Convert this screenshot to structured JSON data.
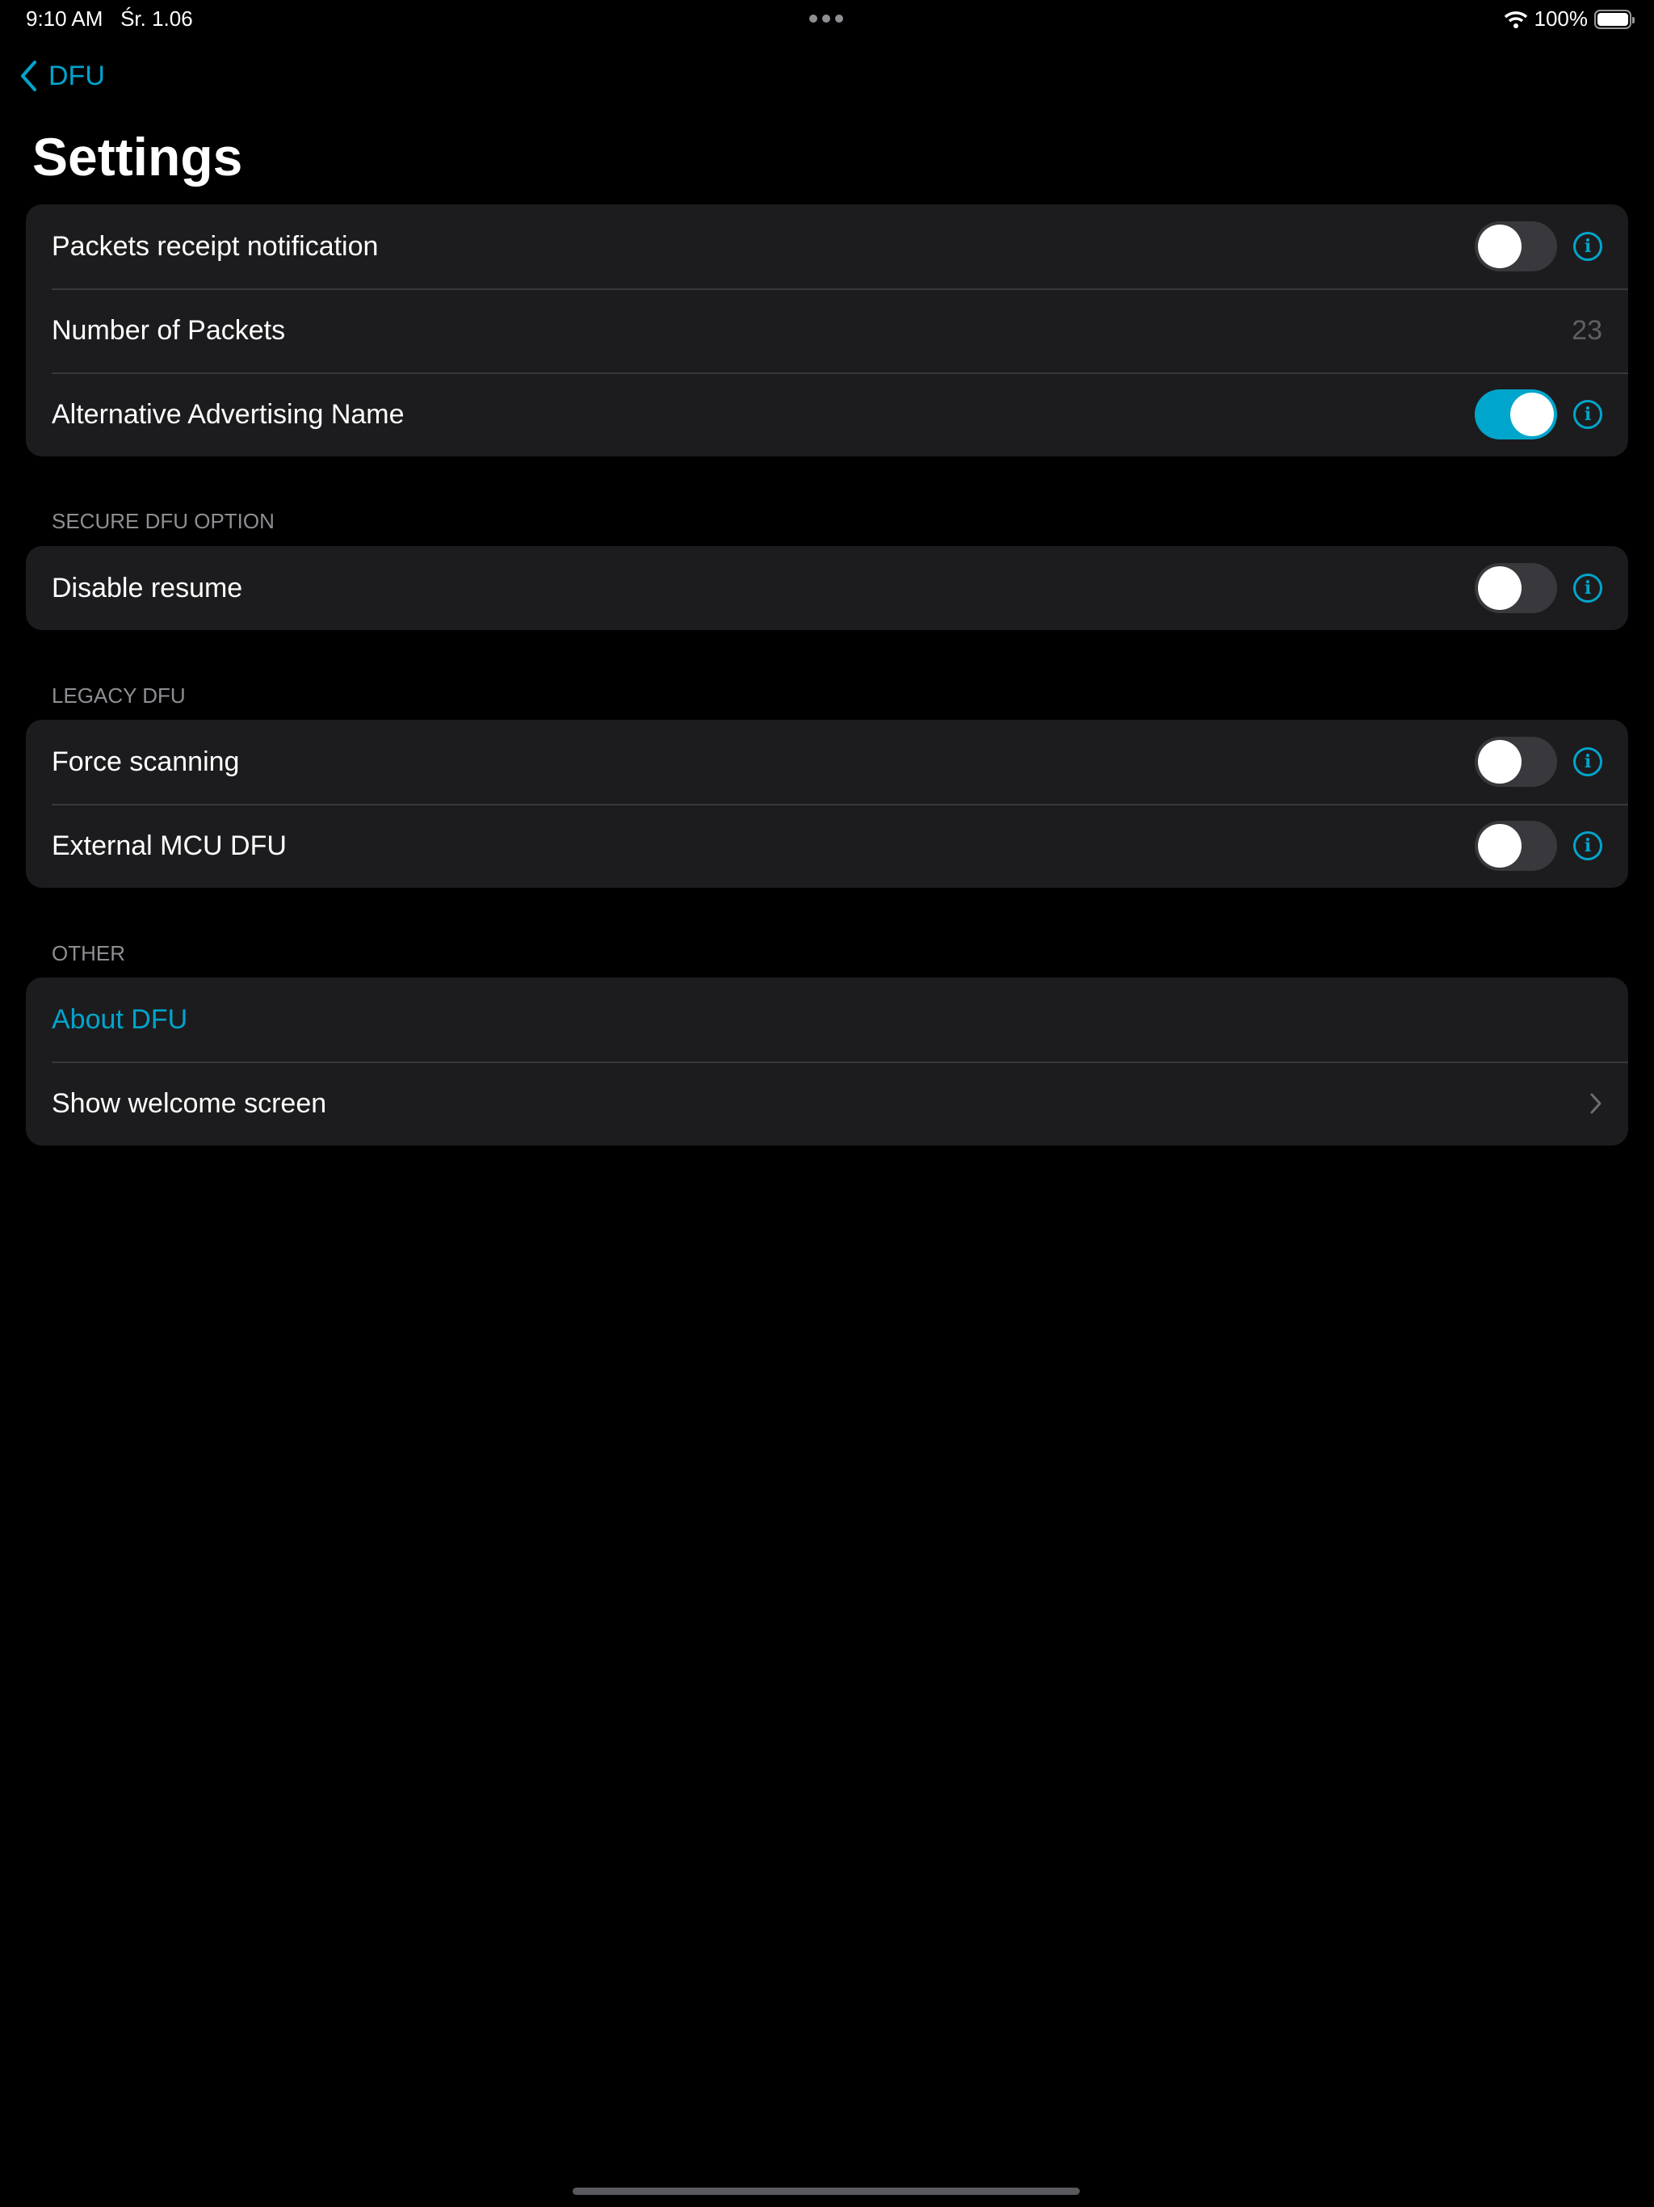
{
  "status_bar": {
    "time": "9:10 AM",
    "date": "Śr. 1.06",
    "battery": "100%"
  },
  "nav": {
    "back_label": "DFU",
    "title": "Settings"
  },
  "accent": "#00a5cc",
  "groups": [
    {
      "header": "",
      "rows": [
        {
          "label": "Packets receipt notification",
          "toggle": false,
          "info": true
        },
        {
          "label": "Number of Packets",
          "value": "23"
        },
        {
          "label": "Alternative Advertising Name",
          "toggle": true,
          "info": true
        }
      ]
    },
    {
      "header": "SECURE DFU OPTION",
      "rows": [
        {
          "label": "Disable resume",
          "toggle": false,
          "info": true
        }
      ]
    },
    {
      "header": "LEGACY DFU",
      "rows": [
        {
          "label": "Force scanning",
          "toggle": false,
          "info": true
        },
        {
          "label": "External MCU DFU",
          "toggle": false,
          "info": true
        }
      ]
    },
    {
      "header": "OTHER",
      "rows": [
        {
          "label": "About DFU",
          "link": true
        },
        {
          "label": "Show welcome screen",
          "chevron": true
        }
      ]
    }
  ]
}
